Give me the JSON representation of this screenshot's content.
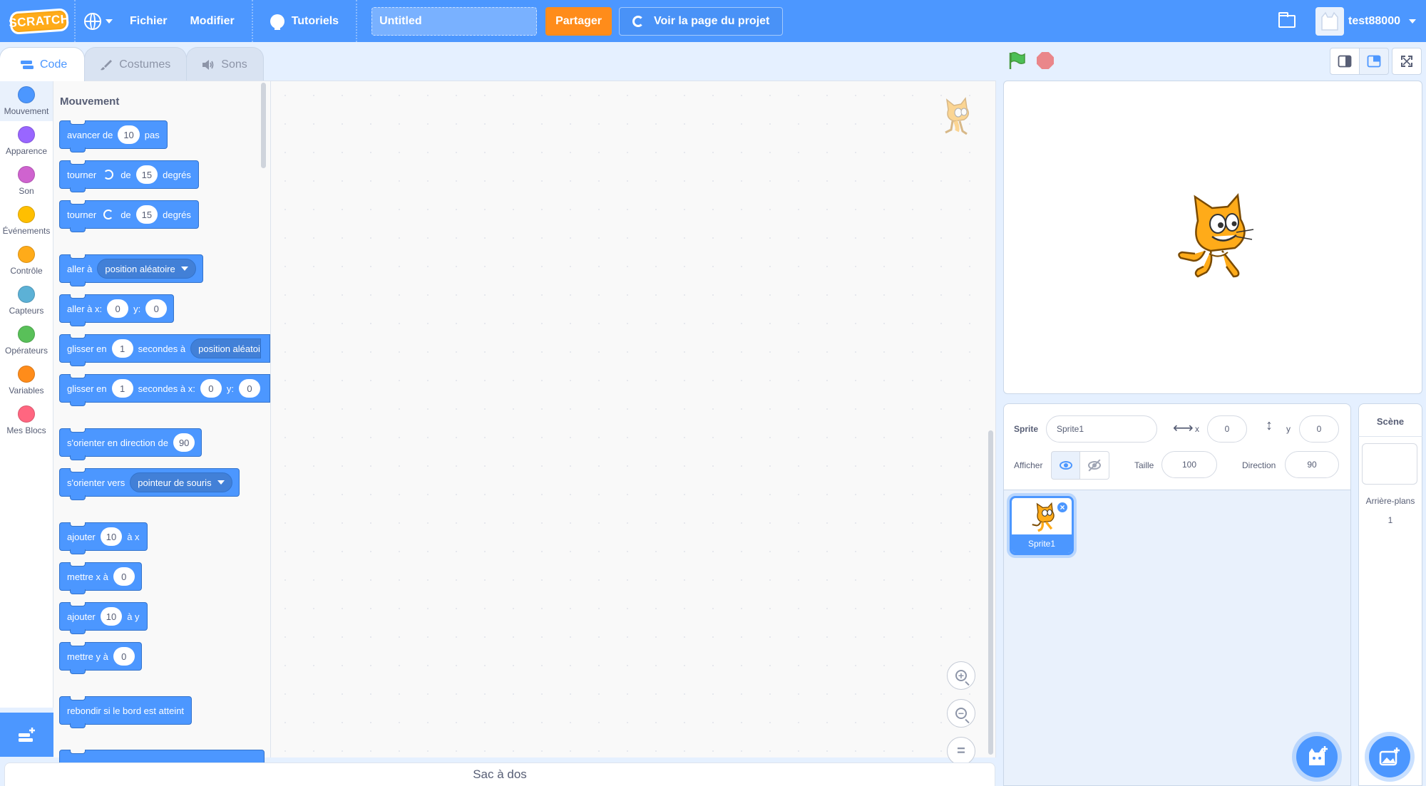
{
  "menubar": {
    "logo_text": "SCRATCH",
    "file": "Fichier",
    "edit": "Modifier",
    "tutorials": "Tutoriels",
    "project_title": "Untitled",
    "share": "Partager",
    "see_project_page": "Voir la page du projet",
    "username": "test88000",
    "bar_color": "#4c97ff"
  },
  "tabs": [
    {
      "label": "Code",
      "icon": "code-icon"
    },
    {
      "label": "Costumes",
      "icon": "brush-icon"
    },
    {
      "label": "Sons",
      "icon": "speaker-icon"
    }
  ],
  "categories": [
    {
      "label": "Mouvement",
      "color": "#4c97ff"
    },
    {
      "label": "Apparence",
      "color": "#9966ff"
    },
    {
      "label": "Son",
      "color": "#cf63cf"
    },
    {
      "label": "Événements",
      "color": "#ffbf00"
    },
    {
      "label": "Contrôle",
      "color": "#ffab19"
    },
    {
      "label": "Capteurs",
      "color": "#5cb1d6"
    },
    {
      "label": "Opérateurs",
      "color": "#59c059"
    },
    {
      "label": "Variables",
      "color": "#ff8c1a"
    },
    {
      "label": "Mes Blocs",
      "color": "#ff6680"
    }
  ],
  "palette": {
    "heading": "Mouvement",
    "blocks": {
      "move": {
        "a": "avancer de",
        "v": "10",
        "b": "pas"
      },
      "turn_right": {
        "a": "tourner",
        "b": "de",
        "v": "15",
        "c": "degrés"
      },
      "turn_left": {
        "a": "tourner",
        "b": "de",
        "v": "15",
        "c": "degrés"
      },
      "goto": {
        "a": "aller à",
        "d": "position aléatoire"
      },
      "goto_xy": {
        "a": "aller à x:",
        "x": "0",
        "b": "y:",
        "y": "0"
      },
      "glide": {
        "a": "glisser en",
        "v": "1",
        "b": "secondes à",
        "d": "position aléatoi"
      },
      "glide_xy": {
        "a": "glisser en",
        "v": "1",
        "b": "secondes à x:",
        "x": "0",
        "c": "y:",
        "y": "0"
      },
      "point_dir": {
        "a": "s'orienter en direction de",
        "v": "90"
      },
      "point_towards": {
        "a": "s'orienter vers",
        "d": "pointeur de souris"
      },
      "change_x": {
        "a": "ajouter",
        "v": "10",
        "b": "à x"
      },
      "set_x": {
        "a": "mettre x à",
        "v": "0"
      },
      "change_y": {
        "a": "ajouter",
        "v": "10",
        "b": "à y"
      },
      "set_y": {
        "a": "mettre y à",
        "v": "0"
      },
      "bounce": {
        "a": "rebondir si le bord est atteint"
      }
    }
  },
  "backpack": "Sac à dos",
  "sprite_info": {
    "sprite_label": "Sprite",
    "sprite_name": "Sprite1",
    "x_label": "x",
    "x_value": "0",
    "y_label": "y",
    "y_value": "0",
    "show_label": "Afficher",
    "size_label": "Taille",
    "size_value": "100",
    "direction_label": "Direction",
    "direction_value": "90"
  },
  "sprites": [
    {
      "name": "Sprite1",
      "selected": true
    }
  ],
  "stage_pane": {
    "title": "Scène",
    "backdrops_label": "Arrière-plans",
    "backdrops_count": "1"
  }
}
